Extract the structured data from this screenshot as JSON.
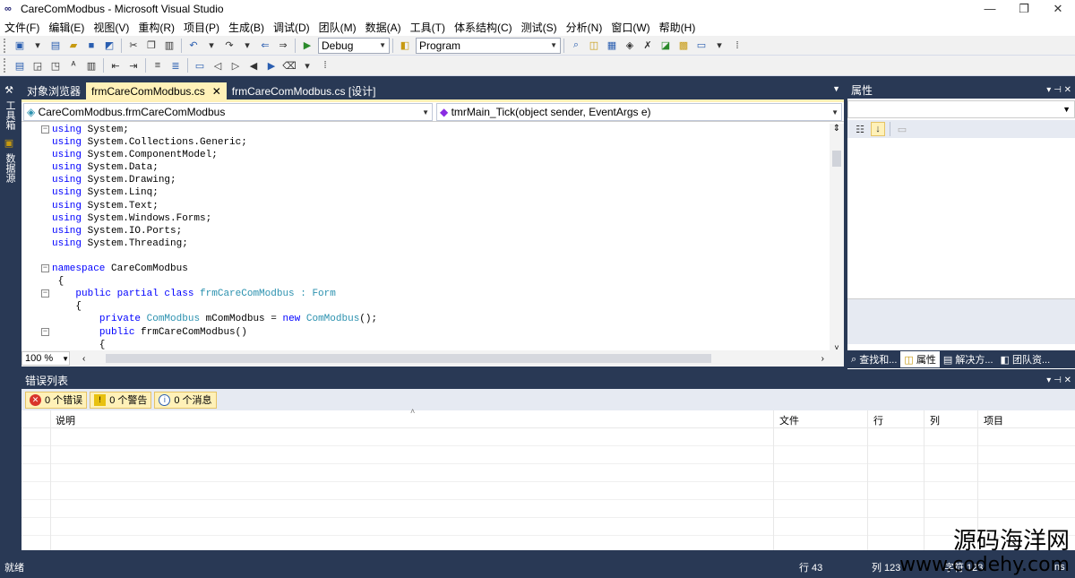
{
  "title": "CareComModbus - Microsoft Visual Studio",
  "menu": [
    "文件(F)",
    "编辑(E)",
    "视图(V)",
    "重构(R)",
    "项目(P)",
    "生成(B)",
    "调试(D)",
    "团队(M)",
    "数据(A)",
    "工具(T)",
    "体系结构(C)",
    "测试(S)",
    "分析(N)",
    "窗口(W)",
    "帮助(H)"
  ],
  "toolbar": {
    "config": "Debug",
    "startup": "Program"
  },
  "leftstrip": {
    "toolbox": "工具箱",
    "datasources": "数据源"
  },
  "tabs": {
    "t1": "对象浏览器",
    "t2": "frmCareComModbus.cs",
    "t3": "frmCareComModbus.cs [设计]"
  },
  "nav": {
    "left": "CareComModbus.frmCareComModbus",
    "right": "tmrMain_Tick(object sender, EventArgs e)"
  },
  "code": [
    {
      "fold": "−",
      "kw": "using",
      "rest": " System;"
    },
    {
      "kw": "using",
      "rest": " System.Collections.Generic;"
    },
    {
      "kw": "using",
      "rest": " System.ComponentModel;"
    },
    {
      "kw": "using",
      "rest": " System.Data;"
    },
    {
      "kw": "using",
      "rest": " System.Drawing;"
    },
    {
      "kw": "using",
      "rest": " System.Linq;"
    },
    {
      "kw": "using",
      "rest": " System.Text;"
    },
    {
      "kw": "using",
      "rest": " System.Windows.Forms;"
    },
    {
      "kw": "using",
      "rest": " System.IO.Ports;"
    },
    {
      "kw": "using",
      "rest": " System.Threading;"
    },
    {
      "rest": ""
    },
    {
      "fold": "−",
      "kw": "namespace",
      "rest": " CareComModbus"
    },
    {
      "rest": " {"
    },
    {
      "fold": "−",
      "pre": "    ",
      "kw": "public partial class",
      "ty": " frmCareComModbus : Form"
    },
    {
      "rest": "    {"
    },
    {
      "pre": "        ",
      "kw": "private",
      "ty": " ComModbus",
      "rest": " mComModbus = ",
      "kw2": "new",
      "ty2": " ComModbus",
      "rest2": "();"
    },
    {
      "fold": "−",
      "pre": "        ",
      "kw": "public",
      "rest": " frmCareComModbus()"
    },
    {
      "rest": "        {"
    }
  ],
  "zoom": "100 %",
  "props": {
    "title": "属性",
    "tabs": [
      "查找和...",
      "属性",
      "解决方...",
      "团队资..."
    ]
  },
  "errors": {
    "title": "错误列表",
    "errors": "0 个错误",
    "warnings": "0 个警告",
    "messages": "0 个消息",
    "cols": [
      "说明",
      "文件",
      "行",
      "列",
      "项目"
    ]
  },
  "status": {
    "ready": "就绪",
    "line": "行 43",
    "col": "列 123",
    "char": "字符 123",
    "ins": "Ins"
  },
  "watermark": {
    "line1": "源码海洋网",
    "line2": "www.codehy.com"
  }
}
